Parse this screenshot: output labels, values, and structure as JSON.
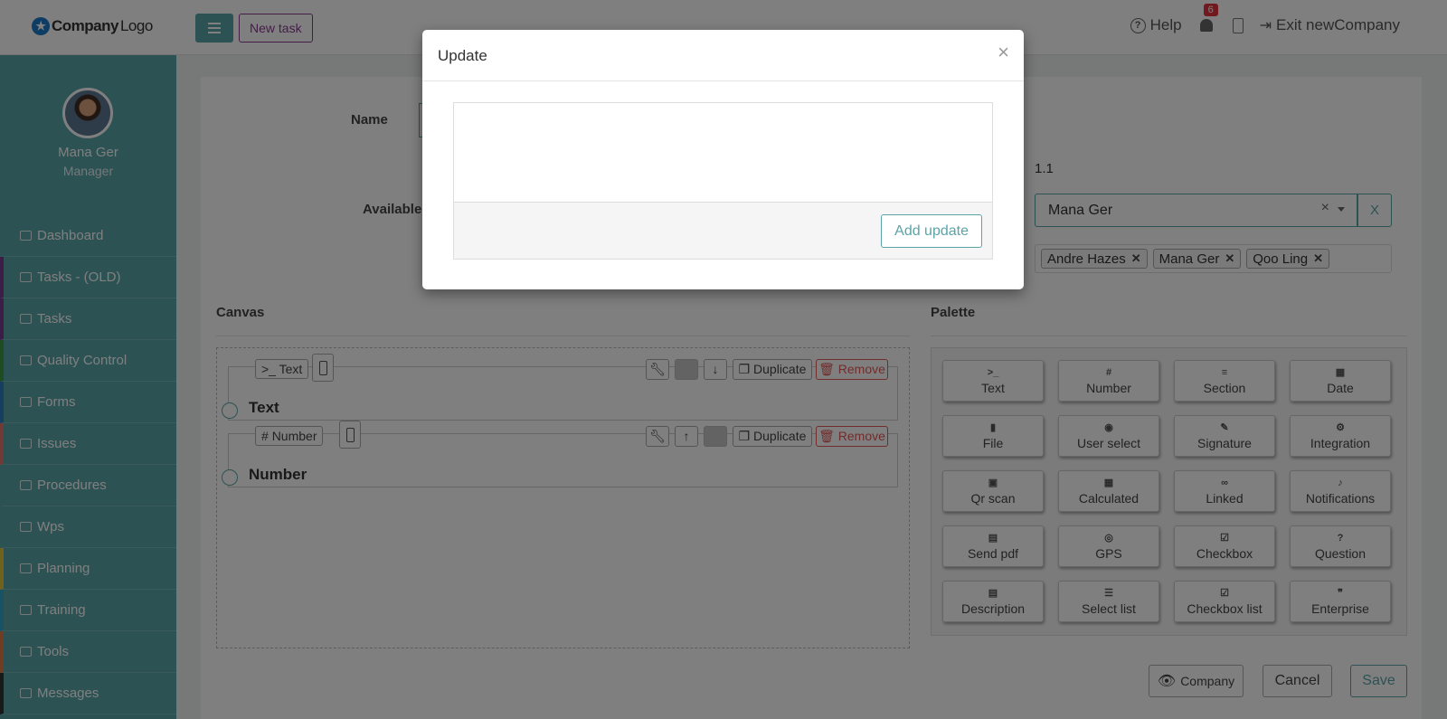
{
  "app": {
    "logo_text_bold": "Company",
    "logo_text_light": "Logo",
    "new_task": "New task",
    "help": "Help",
    "notification_count": "6",
    "exit": "Exit newCompany"
  },
  "user": {
    "name": "Mana Ger",
    "role": "Manager"
  },
  "sidebar": {
    "items": [
      {
        "label": "Dashboard",
        "color": "#5aa4a7"
      },
      {
        "label": "Tasks - (OLD)",
        "color": "#7a3b8f"
      },
      {
        "label": "Tasks",
        "color": "#7a3b8f"
      },
      {
        "label": "Quality Control",
        "color": "#3f9a45"
      },
      {
        "label": "Forms",
        "color": "#2b7fc1"
      },
      {
        "label": "Issues",
        "color": "#e2746f"
      },
      {
        "label": "Procedures",
        "color": "#5aa4a7"
      },
      {
        "label": "Wps",
        "color": "#5aa4a7"
      },
      {
        "label": "Planning",
        "color": "#e0c23a"
      },
      {
        "label": "Training",
        "color": "#2fa7c9"
      },
      {
        "label": "Tools",
        "color": "#e07b45"
      },
      {
        "label": "Messages",
        "color": "#333333"
      }
    ]
  },
  "form": {
    "name_label": "Name",
    "available_label": "Available",
    "version": "1.1",
    "owner_value": "Mana Ger",
    "owner_clear": "X",
    "tags": [
      "Andre Hazes",
      "Mana Ger",
      "Qoo Ling"
    ]
  },
  "canvas": {
    "title": "Canvas",
    "fields": [
      {
        "type_icon": ">_",
        "type_label": "Text",
        "title": "Text",
        "duplicate": "Duplicate",
        "remove": "Remove"
      },
      {
        "type_icon": "#",
        "type_label": "Number",
        "title": "Number",
        "duplicate": "Duplicate",
        "remove": "Remove"
      }
    ]
  },
  "palette": {
    "title": "Palette",
    "items": [
      {
        "label": "Text",
        "icon": ">_"
      },
      {
        "label": "Number",
        "icon": "#"
      },
      {
        "label": "Section",
        "icon": "≡"
      },
      {
        "label": "Date",
        "icon": "▦"
      },
      {
        "label": "File",
        "icon": "▮"
      },
      {
        "label": "User select",
        "icon": "◉"
      },
      {
        "label": "Signature",
        "icon": "✎"
      },
      {
        "label": "Integration",
        "icon": "⚙"
      },
      {
        "label": "Qr scan",
        "icon": "▣"
      },
      {
        "label": "Calculated",
        "icon": "▦"
      },
      {
        "label": "Linked",
        "icon": "∞"
      },
      {
        "label": "Notifications",
        "icon": "♪"
      },
      {
        "label": "Send pdf",
        "icon": "▤"
      },
      {
        "label": "GPS",
        "icon": "◎"
      },
      {
        "label": "Checkbox",
        "icon": "☑"
      },
      {
        "label": "Question",
        "icon": "?"
      },
      {
        "label": "Description",
        "icon": "▤"
      },
      {
        "label": "Select list",
        "icon": "☰"
      },
      {
        "label": "Checkbox list",
        "icon": "☑"
      },
      {
        "label": "Enterprise",
        "icon": "❞"
      }
    ]
  },
  "footer": {
    "company": "Company",
    "cancel": "Cancel",
    "save": "Save"
  },
  "modal": {
    "title": "Update",
    "close": "×",
    "add_update": "Add update"
  },
  "colors": {
    "accent": "#5aa4a7",
    "purple": "#8a3a93",
    "danger": "#e25858"
  }
}
